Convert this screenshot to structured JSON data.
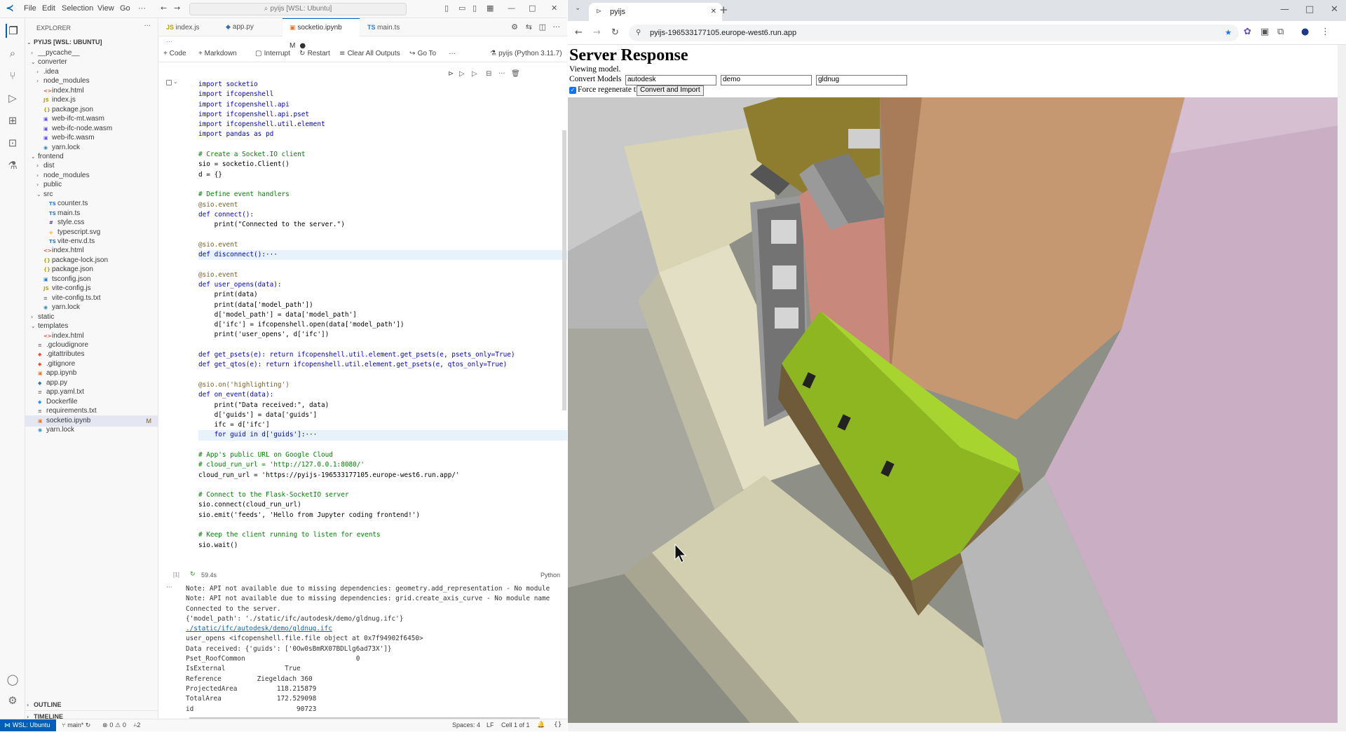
{
  "vscode": {
    "menu": [
      "File",
      "Edit",
      "Selection",
      "View",
      "Go",
      "···"
    ],
    "command_center": "pyijs [WSL: Ubuntu]",
    "explorer_title": "EXPLORER",
    "workspace": "PYIJS [WSL: UBUNTU]",
    "tree": [
      {
        "label": "__pycache__",
        "indent": 1,
        "type": "folder",
        "open": false
      },
      {
        "label": "converter",
        "indent": 1,
        "type": "folder",
        "open": true
      },
      {
        "label": ".idea",
        "indent": 2,
        "type": "folder",
        "open": false
      },
      {
        "label": "node_modules",
        "indent": 2,
        "type": "folder",
        "open": false
      },
      {
        "label": "index.html",
        "indent": 2,
        "type": "html"
      },
      {
        "label": "index.js",
        "indent": 2,
        "type": "js"
      },
      {
        "label": "package.json",
        "indent": 2,
        "type": "json"
      },
      {
        "label": "web-ifc-mt.wasm",
        "indent": 2,
        "type": "wasm"
      },
      {
        "label": "web-ifc-node.wasm",
        "indent": 2,
        "type": "wasm"
      },
      {
        "label": "web-ifc.wasm",
        "indent": 2,
        "type": "wasm"
      },
      {
        "label": "yarn.lock",
        "indent": 2,
        "type": "yarn"
      },
      {
        "label": "frontend",
        "indent": 1,
        "type": "folder",
        "open": true
      },
      {
        "label": "dist",
        "indent": 2,
        "type": "folder",
        "open": false
      },
      {
        "label": "node_modules",
        "indent": 2,
        "type": "folder",
        "open": false
      },
      {
        "label": "public",
        "indent": 2,
        "type": "folder",
        "open": false
      },
      {
        "label": "src",
        "indent": 2,
        "type": "folder",
        "open": true
      },
      {
        "label": "counter.ts",
        "indent": 3,
        "type": "ts"
      },
      {
        "label": "main.ts",
        "indent": 3,
        "type": "ts"
      },
      {
        "label": "style.css",
        "indent": 3,
        "type": "css"
      },
      {
        "label": "typescript.svg",
        "indent": 3,
        "type": "svg"
      },
      {
        "label": "vite-env.d.ts",
        "indent": 3,
        "type": "ts"
      },
      {
        "label": "index.html",
        "indent": 2,
        "type": "html"
      },
      {
        "label": "package-lock.json",
        "indent": 2,
        "type": "json"
      },
      {
        "label": "package.json",
        "indent": 2,
        "type": "json"
      },
      {
        "label": "tsconfig.json",
        "indent": 2,
        "type": "tsconfig"
      },
      {
        "label": "vite-config.js",
        "indent": 2,
        "type": "js"
      },
      {
        "label": "vite-config.ts.txt",
        "indent": 2,
        "type": "txt"
      },
      {
        "label": "yarn.lock",
        "indent": 2,
        "type": "yarn"
      },
      {
        "label": "static",
        "indent": 1,
        "type": "folder",
        "open": false
      },
      {
        "label": "templates",
        "indent": 1,
        "type": "folder",
        "open": true
      },
      {
        "label": "index.html",
        "indent": 2,
        "type": "html"
      },
      {
        "label": ".gcloudignore",
        "indent": 1,
        "type": "txt"
      },
      {
        "label": ".gitattributes",
        "indent": 1,
        "type": "git"
      },
      {
        "label": ".gitignore",
        "indent": 1,
        "type": "git"
      },
      {
        "label": "app.ipynb",
        "indent": 1,
        "type": "nb"
      },
      {
        "label": "app.py",
        "indent": 1,
        "type": "py"
      },
      {
        "label": "app.yaml.txt",
        "indent": 1,
        "type": "txt"
      },
      {
        "label": "Dockerfile",
        "indent": 1,
        "type": "docker"
      },
      {
        "label": "requirements.txt",
        "indent": 1,
        "type": "txt"
      },
      {
        "label": "socketio.ipynb",
        "indent": 1,
        "type": "nb",
        "selected": true,
        "badge": "M"
      },
      {
        "label": "yarn.lock",
        "indent": 1,
        "type": "yarn"
      }
    ],
    "outline_label": "OUTLINE",
    "timeline_label": "TIMELINE",
    "tabs": [
      {
        "label": "index.js",
        "icon": "JS"
      },
      {
        "label": "app.py",
        "icon": "py"
      },
      {
        "label": "socketio.ipynb M",
        "icon": "nb",
        "active": true
      },
      {
        "label": "main.ts",
        "icon": "TS"
      }
    ],
    "nb_toolbar": {
      "code": "+ Code",
      "markdown": "+ Markdown",
      "interrupt": "Interrupt",
      "restart": "Restart",
      "clear": "Clear All Outputs",
      "goto": "Go To",
      "more": "···",
      "kernel": "pyijs (Python 3.11.7)"
    },
    "cell_exec_count": "[1]",
    "cell_time": "59.4s",
    "cell_lang": "Python",
    "code_lines": [
      "import socketio",
      "import ifcopenshell",
      "import ifcopenshell.api",
      "import ifcopenshell.api.pset",
      "import ifcopenshell.util.element",
      "import pandas as pd",
      "",
      "# Create a Socket.IO client",
      "sio = socketio.Client()",
      "d = {}",
      "",
      "# Define event handlers",
      "@sio.event",
      "def connect():",
      "    print(\"Connected to the server.\")",
      "",
      "@sio.event",
      "def disconnect():···",
      "",
      "@sio.event",
      "def user_opens(data):",
      "    print(data)",
      "    print(data['model_path'])",
      "    d['model_path'] = data['model_path']",
      "    d['ifc'] = ifcopenshell.open(data['model_path'])",
      "    print('user_opens', d['ifc'])",
      "",
      "def get_psets(e): return ifcopenshell.util.element.get_psets(e, psets_only=True)",
      "def get_qtos(e): return ifcopenshell.util.element.get_psets(e, qtos_only=True)",
      "",
      "@sio.on('highlighting')",
      "def on_event(data):",
      "    print(\"Data received:\", data)",
      "    d['guids'] = data['guids']",
      "    ifc = d['ifc']",
      "    for guid in d['guids']:···",
      "",
      "# App's public URL on Google Cloud",
      "# cloud_run_url = 'http://127.0.0.1:8080/'",
      "cloud_run_url = 'https://pyijs-196533177105.europe-west6.run.app/'",
      "",
      "# Connect to the Flask-SocketIO server",
      "sio.connect(cloud_run_url)",
      "sio.emit('feeds', 'Hello from Jupyter coding frontend!')",
      "",
      "# Keep the client running to listen for events",
      "sio.wait()"
    ],
    "output_lines": [
      "Note: API not available due to missing dependencies: geometry.add_representation - No module",
      "Note: API not available due to missing dependencies: grid.create_axis_curve - No module name",
      "Connected to the server.",
      "{'model_path': './static/ifc/autodesk/demo/gldnug.ifc'}",
      "./static/ifc/autodesk/demo/gldnug.ifc",
      "user_opens <ifcopenshell.file.file object at 0x7f94902f6450>",
      "Data received: {'guids': ['0Ow0sBmRX07BDLlg6ad73X']}",
      "Pset_RoofCommon                            0",
      "IsExternal               True",
      "Reference         Ziegeldach 360",
      "ProjectedArea          118.215879",
      "TotalArea              172.529098",
      "id                          90723"
    ],
    "status": {
      "remote": "WSL: Ubuntu",
      "branch": "main*",
      "errors": "0",
      "warnings": "0",
      "ports": "2",
      "spaces": "Spaces: 4",
      "eol": "LF",
      "cell": "Cell 1 of 1"
    }
  },
  "browser": {
    "tab_title": "pyijs",
    "url": "pyijs-196533177105.europe-west6.run.app",
    "page": {
      "heading": "Server Response",
      "status": "Viewing model.",
      "convert_label": "Convert Models",
      "inputs": [
        "autodesk",
        "demo",
        "gldnug"
      ],
      "checkbox_label": "Force regenerate tiles",
      "checkbox_checked": true,
      "button": "Convert and Import"
    }
  }
}
